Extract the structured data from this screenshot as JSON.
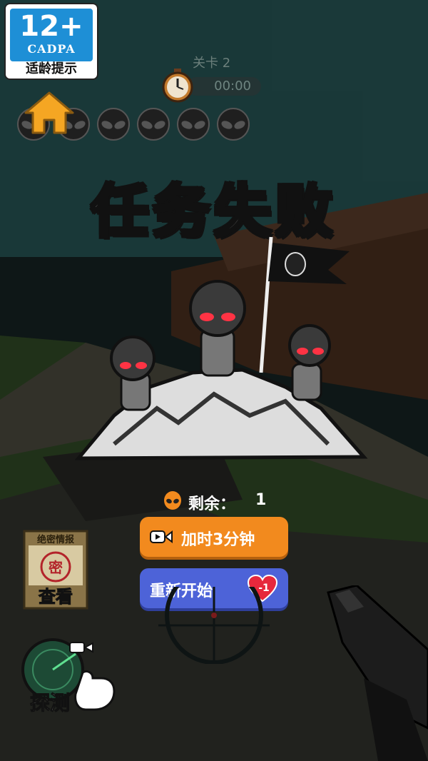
{
  "age_rating": {
    "number": "12+",
    "org": "CADPA",
    "tip": "适龄提示"
  },
  "hud": {
    "level": "关卡 2",
    "timer": "00:00",
    "alien_slots": 6
  },
  "result": {
    "title": "任务失败"
  },
  "remaining": {
    "label": "剩余：",
    "value": "1"
  },
  "buttons": {
    "add_time": "加时3分钟",
    "restart": "重新开始",
    "restart_cost": "-1"
  },
  "secret_card": {
    "header": "绝密情报",
    "stamp": "密",
    "action": "查看"
  },
  "radar": {
    "label": "探测"
  },
  "colors": {
    "add_time": "#f28a1e",
    "restart": "#4d63d8",
    "home": "#f5a623",
    "age_blue": "#1e8fd6"
  }
}
